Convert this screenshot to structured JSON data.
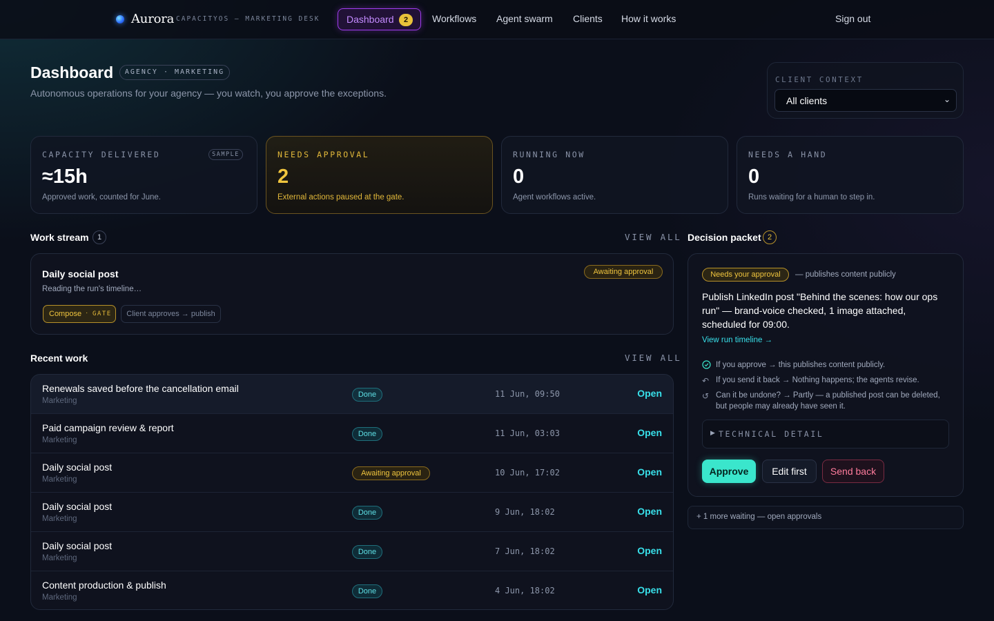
{
  "nav": {
    "brand": "Aurora",
    "tagline": "CAPACITYOS — MARKETING DESK",
    "active_label": "Dashboard",
    "active_count": "2",
    "links": [
      "Workflows",
      "Agent swarm",
      "Clients",
      "How it works"
    ],
    "sign_out": "Sign out"
  },
  "header": {
    "title": "Dashboard",
    "pill": "AGENCY · MARKETING",
    "subtitle": "Autonomous operations for your agency — you watch, you approve the exceptions."
  },
  "client_context": {
    "label": "CLIENT CONTEXT",
    "selected": "All clients"
  },
  "stats": [
    {
      "label": "CAPACITY DELIVERED",
      "badge": "SAMPLE",
      "value": "≈15h",
      "sub": "Approved work, counted for June."
    },
    {
      "label": "NEEDS APPROVAL",
      "value": "2",
      "sub": "External actions paused at the gate."
    },
    {
      "label": "RUNNING NOW",
      "value": "0",
      "sub": "Agent workflows active."
    },
    {
      "label": "NEEDS A HAND",
      "value": "0",
      "sub": "Runs waiting for a human to step in."
    }
  ],
  "work_stream": {
    "title": "Work stream",
    "count": "1",
    "view_all": "VIEW ALL",
    "item": {
      "title": "Daily social post",
      "status": "Awaiting approval",
      "detail": "Reading the run's timeline…",
      "step_current": "Compose",
      "step_gate": "GATE",
      "step_next": "Client approves → publish"
    }
  },
  "recent_work": {
    "title": "Recent work",
    "view_all": "VIEW ALL",
    "open_label": "Open",
    "rows": [
      {
        "name": "Renewals saved before the cancellation email",
        "category": "Marketing",
        "status": "Done",
        "time": "11 Jun, 09:50"
      },
      {
        "name": "Paid campaign review & report",
        "category": "Marketing",
        "status": "Done",
        "time": "11 Jun, 03:03"
      },
      {
        "name": "Daily social post",
        "category": "Marketing",
        "status": "Awaiting approval",
        "time": "10 Jun, 17:02"
      },
      {
        "name": "Daily social post",
        "category": "Marketing",
        "status": "Done",
        "time": "9 Jun, 18:02"
      },
      {
        "name": "Daily social post",
        "category": "Marketing",
        "status": "Done",
        "time": "7 Jun, 18:02"
      },
      {
        "name": "Content production & publish",
        "category": "Marketing",
        "status": "Done",
        "time": "4 Jun, 18:02"
      }
    ]
  },
  "decision_packet": {
    "title": "Decision packet",
    "count": "2",
    "badge": "Needs your approval",
    "note": "— publishes content publicly",
    "headline": "Publish LinkedIn post \"Behind the scenes: how our ops run\" — brand-voice checked, 1 image attached, scheduled for 09:00.",
    "timeline_link": "View run timeline →",
    "consequences": [
      {
        "icon": "check-circle-icon",
        "text": "If you approve → this publishes content publicly."
      },
      {
        "icon": "send-back-icon",
        "text": "If you send it back → Nothing happens; the agents revise."
      },
      {
        "icon": "undo-icon",
        "text": "Can it be undone? → Partly — a published post can be deleted, but people may already have seen it."
      }
    ],
    "technical_detail": "TECHNICAL DETAIL",
    "approve": "Approve",
    "edit_first": "Edit first",
    "send_back": "Send back",
    "more": "+ 1 more waiting — open approvals"
  },
  "colors": {
    "accent_teal": "#38e0ea",
    "approve_green": "#3ae6cc",
    "warn_gold": "#f0c53e",
    "nav_purple": "#a23df0",
    "danger_pink": "#ff7c9c"
  }
}
